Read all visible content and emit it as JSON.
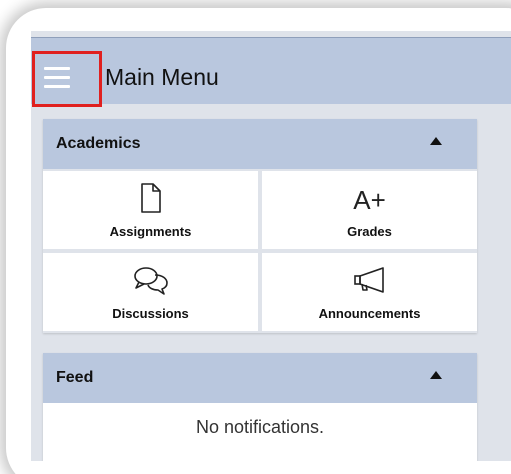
{
  "appbar": {
    "title": "Main Menu",
    "menu_icon": "hamburger-menu-icon",
    "highlight_color": "#e0201f"
  },
  "academics": {
    "header": "Academics",
    "toggle_icon": "caret-up-icon",
    "tiles": [
      {
        "label": "Assignments",
        "icon": "document-icon"
      },
      {
        "label": "Grades",
        "icon": "grade-a-plus-icon",
        "glyph": "A+"
      },
      {
        "label": "Discussions",
        "icon": "chat-bubbles-icon"
      },
      {
        "label": "Announcements",
        "icon": "megaphone-icon"
      }
    ]
  },
  "feed": {
    "header": "Feed",
    "toggle_icon": "caret-up-icon",
    "empty_text": "No notifications."
  },
  "colors": {
    "header_bg": "#b9c7de",
    "screen_bg": "#dfe3ea",
    "tile_bg": "#ffffff"
  }
}
